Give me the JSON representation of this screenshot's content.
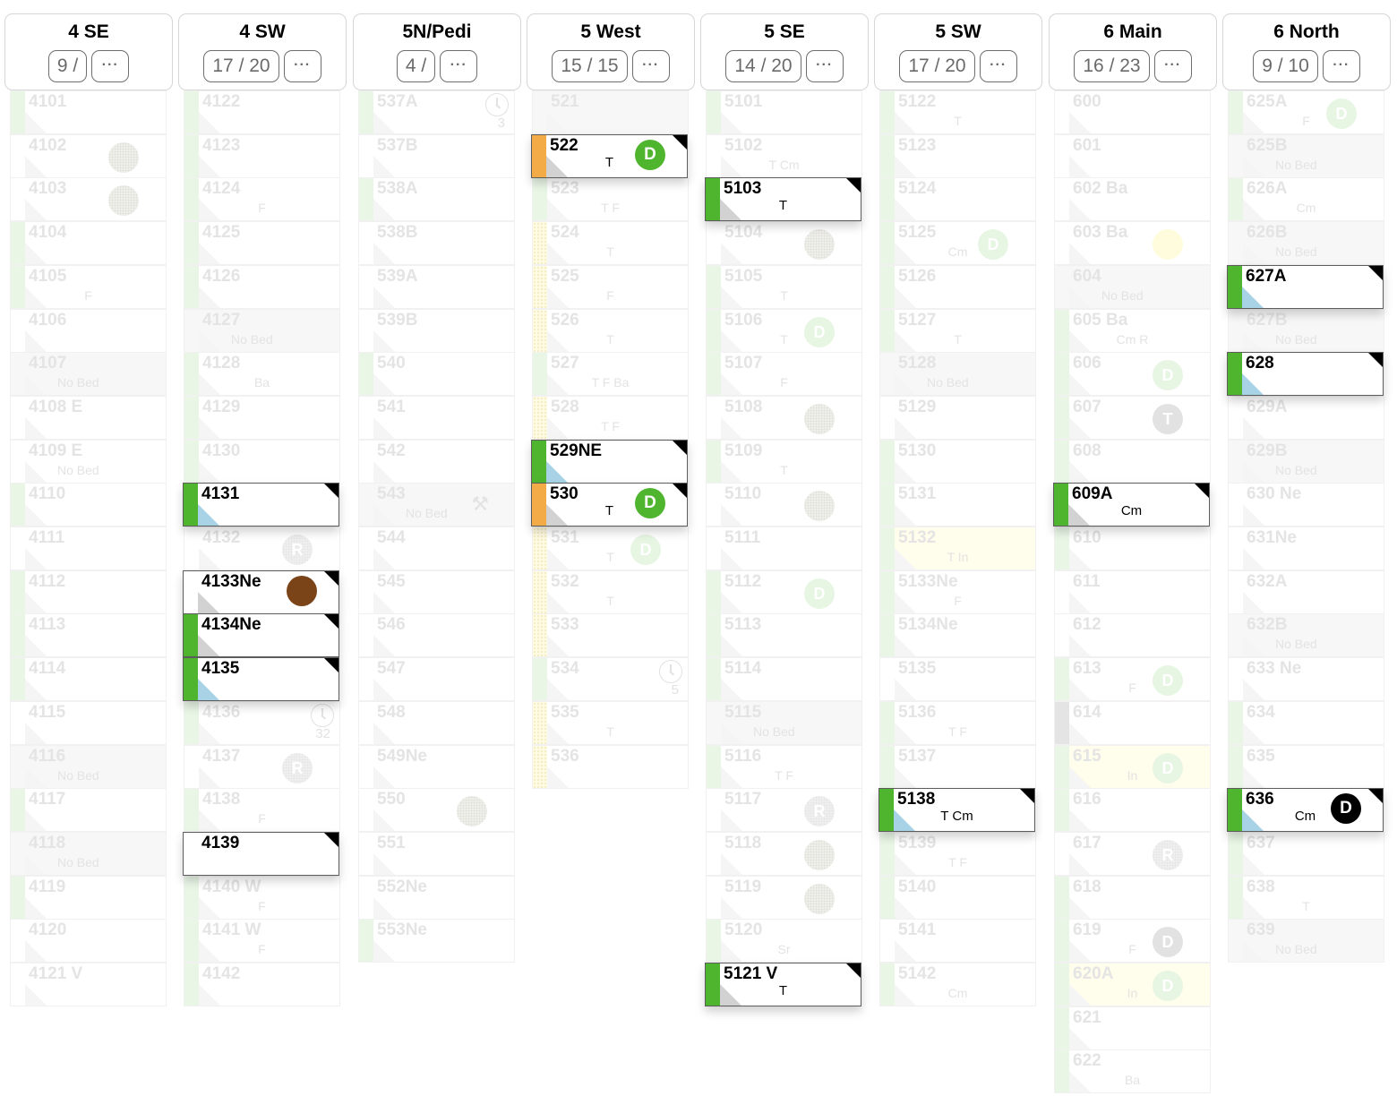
{
  "units": [
    {
      "name": "4 SE",
      "count": "9 /",
      "more": "···",
      "rooms": [
        {
          "n": "4101",
          "strip": "green"
        },
        {
          "n": "4102",
          "badge": "dot"
        },
        {
          "n": "4103",
          "badge": "dot"
        },
        {
          "n": "4104",
          "strip": "green"
        },
        {
          "n": "4105",
          "strip": "green",
          "sub": "F"
        },
        {
          "n": "4106"
        },
        {
          "n": "4107",
          "nobed": true,
          "sub": "No Bed"
        },
        {
          "n": "4108 E"
        },
        {
          "n": "4109 E",
          "nobed": false,
          "sub": "No Bed"
        },
        {
          "n": "4110",
          "strip": "green"
        },
        {
          "n": "4111"
        },
        {
          "n": "4112",
          "strip": "green"
        },
        {
          "n": "4113",
          "strip": "green"
        },
        {
          "n": "4114",
          "strip": "green"
        },
        {
          "n": "4115"
        },
        {
          "n": "4116",
          "nobed": true,
          "sub": "No Bed"
        },
        {
          "n": "4117",
          "strip": "green"
        },
        {
          "n": "4118",
          "nobed": true,
          "sub": "No Bed"
        },
        {
          "n": "4119",
          "strip": "green"
        },
        {
          "n": "4120"
        },
        {
          "n": "4121 V"
        }
      ],
      "cards": []
    },
    {
      "name": "4 SW",
      "count": "17 / 20",
      "more": "···",
      "rooms": [
        {
          "n": "4122",
          "strip": "green"
        },
        {
          "n": "4123",
          "strip": "green"
        },
        {
          "n": "4124",
          "strip": "green",
          "sub": "F"
        },
        {
          "n": "4125",
          "strip": "green"
        },
        {
          "n": "4126",
          "strip": "green"
        },
        {
          "n": "4127",
          "nobed": true,
          "sub": "No Bed"
        },
        {
          "n": "4128",
          "strip": "green",
          "sub": "Ba"
        },
        {
          "n": "4129",
          "strip": "green"
        },
        {
          "n": "4130",
          "strip": "green"
        },
        {
          "n": "4131",
          "hidden": true
        },
        {
          "n": "4132",
          "badge": "r",
          "badgeText": "R"
        },
        {
          "n": "4133Ne",
          "hidden": true
        },
        {
          "n": "4134Ne",
          "hidden": true
        },
        {
          "n": "4135",
          "hidden": true
        },
        {
          "n": "4136",
          "strip": "green",
          "clock": "32"
        },
        {
          "n": "4137",
          "badge": "r",
          "badgeText": "R"
        },
        {
          "n": "4138",
          "strip": "green",
          "sub": "F"
        },
        {
          "n": "4139",
          "hidden": true
        },
        {
          "n": "4140 W",
          "strip": "green",
          "sub": "F"
        },
        {
          "n": "4141 W",
          "strip": "green",
          "sub": "F"
        },
        {
          "n": "4142",
          "strip": "green"
        }
      ],
      "cards": [
        {
          "row": 9,
          "n": "4131",
          "strip": "green",
          "tri": "blue"
        },
        {
          "row": 11,
          "n": "4133Ne",
          "tri": "gray",
          "badge": "brown",
          "badgeText": ""
        },
        {
          "row": 12,
          "n": "4134Ne",
          "strip": "green",
          "tri": "gray"
        },
        {
          "row": 13,
          "n": "4135",
          "strip": "green",
          "tri": "blue"
        },
        {
          "row": 17,
          "n": "4139"
        }
      ]
    },
    {
      "name": "5N/Pedi",
      "count": "4 /",
      "more": "···",
      "rooms": [
        {
          "n": "537A",
          "strip": "green",
          "clock": "3"
        },
        {
          "n": "537B"
        },
        {
          "n": "538A",
          "strip": "green"
        },
        {
          "n": "538B"
        },
        {
          "n": "539A"
        },
        {
          "n": "539B"
        },
        {
          "n": "540",
          "strip": "green"
        },
        {
          "n": "541"
        },
        {
          "n": "542"
        },
        {
          "n": "543",
          "nobed": true,
          "sub": "No Bed",
          "wrench": true
        },
        {
          "n": "544"
        },
        {
          "n": "545"
        },
        {
          "n": "546"
        },
        {
          "n": "547"
        },
        {
          "n": "548"
        },
        {
          "n": "549Ne"
        },
        {
          "n": "550",
          "badge": "dot"
        },
        {
          "n": "551"
        },
        {
          "n": "552Ne"
        },
        {
          "n": "553Ne",
          "strip": "green"
        }
      ],
      "cards": []
    },
    {
      "name": "5 West",
      "count": "15 / 15",
      "more": "···",
      "rooms": [
        {
          "n": "521",
          "nobed": true
        },
        {
          "n": "522",
          "hidden": true
        },
        {
          "n": "523",
          "strip": "green",
          "sub": "T F"
        },
        {
          "n": "524",
          "strip": "yellowdot",
          "sub": "T"
        },
        {
          "n": "525",
          "strip": "yellowdot",
          "sub": "F"
        },
        {
          "n": "526",
          "strip": "yellowdot",
          "sub": "T"
        },
        {
          "n": "527",
          "strip": "green",
          "sub": "T F Ba"
        },
        {
          "n": "528",
          "strip": "yellowdot",
          "sub": "T F"
        },
        {
          "n": "529NE",
          "hidden": true
        },
        {
          "n": "530",
          "hidden": true
        },
        {
          "n": "531",
          "strip": "yellowdot",
          "sub": "T",
          "badge": "dgreen",
          "badgeText": "D"
        },
        {
          "n": "532",
          "strip": "yellowdot",
          "sub": "T"
        },
        {
          "n": "533",
          "strip": "yellowdot"
        },
        {
          "n": "534",
          "strip": "green",
          "clock": "5"
        },
        {
          "n": "535",
          "strip": "yellowdot",
          "sub": "T"
        },
        {
          "n": "536",
          "strip": "yellowdot"
        }
      ],
      "cards": [
        {
          "row": 1,
          "n": "522",
          "strip": "orange",
          "tri": "gray",
          "sub": "T",
          "badge": "green",
          "badgeText": "D"
        },
        {
          "row": 8,
          "n": "529NE",
          "strip": "green",
          "tri": "blue"
        },
        {
          "row": 9,
          "n": "530",
          "strip": "orange",
          "tri": "gray",
          "sub": "T",
          "badge": "green",
          "badgeText": "D"
        }
      ]
    },
    {
      "name": "5 SE",
      "count": "14 / 20",
      "more": "···",
      "rooms": [
        {
          "n": "5101",
          "strip": "green"
        },
        {
          "n": "5102",
          "sub": "T Cm"
        },
        {
          "n": "5103",
          "hidden": true
        },
        {
          "n": "5104",
          "badge": "dot"
        },
        {
          "n": "5105",
          "strip": "green",
          "sub": "T"
        },
        {
          "n": "5106",
          "strip": "green",
          "sub": "T",
          "badge": "dgreen",
          "badgeText": "D"
        },
        {
          "n": "5107",
          "strip": "green",
          "sub": "F"
        },
        {
          "n": "5108",
          "badge": "dot"
        },
        {
          "n": "5109",
          "strip": "green",
          "sub": "T"
        },
        {
          "n": "5110",
          "badge": "dot"
        },
        {
          "n": "5111"
        },
        {
          "n": "5112",
          "strip": "green",
          "badge": "dgreen",
          "badgeText": "D"
        },
        {
          "n": "5113",
          "strip": "green"
        },
        {
          "n": "5114",
          "strip": "green"
        },
        {
          "n": "5115",
          "nobed": true,
          "sub": "No Bed"
        },
        {
          "n": "5116",
          "strip": "green",
          "sub": "T F"
        },
        {
          "n": "5117",
          "badge": "r",
          "badgeText": "R"
        },
        {
          "n": "5118",
          "badge": "dot"
        },
        {
          "n": "5119",
          "badge": "dot"
        },
        {
          "n": "5120",
          "strip": "green",
          "sub": "Sr"
        },
        {
          "n": "5121 V",
          "hidden": true
        }
      ],
      "cards": [
        {
          "row": 2,
          "n": "5103",
          "strip": "green",
          "tri": "gray",
          "sub": "T"
        },
        {
          "row": 20,
          "n": "5121 V",
          "strip": "green",
          "tri": "gray",
          "sub": "T"
        }
      ]
    },
    {
      "name": "5 SW",
      "count": "17 / 20",
      "more": "···",
      "rooms": [
        {
          "n": "5122",
          "strip": "green",
          "sub": "T"
        },
        {
          "n": "5123",
          "strip": "green"
        },
        {
          "n": "5124",
          "strip": "green"
        },
        {
          "n": "5125",
          "strip": "green",
          "sub": "Cm",
          "badge": "dgreen",
          "badgeText": "D"
        },
        {
          "n": "5126",
          "strip": "green"
        },
        {
          "n": "5127",
          "strip": "green",
          "sub": "T"
        },
        {
          "n": "5128",
          "nobed": true,
          "sub": "No Bed"
        },
        {
          "n": "5129"
        },
        {
          "n": "5130",
          "strip": "green"
        },
        {
          "n": "5131",
          "strip": "green"
        },
        {
          "n": "5132",
          "strip": "green",
          "yellow": true,
          "sub": "T In"
        },
        {
          "n": "5133Ne",
          "strip": "green",
          "sub": "F"
        },
        {
          "n": "5134Ne",
          "strip": "green"
        },
        {
          "n": "5135"
        },
        {
          "n": "5136",
          "strip": "green",
          "sub": "T F"
        },
        {
          "n": "5137",
          "strip": "green"
        },
        {
          "n": "5138",
          "hidden": true
        },
        {
          "n": "5139",
          "strip": "green",
          "sub": "T F"
        },
        {
          "n": "5140",
          "strip": "green"
        },
        {
          "n": "5141"
        },
        {
          "n": "5142",
          "strip": "green",
          "sub": "Cm"
        }
      ],
      "cards": [
        {
          "row": 16,
          "n": "5138",
          "strip": "green",
          "tri": "blue",
          "sub": "T Cm"
        }
      ]
    },
    {
      "name": "6 Main",
      "count": "16 / 23",
      "more": "···",
      "rooms": [
        {
          "n": "600"
        },
        {
          "n": "601"
        },
        {
          "n": "602 Ba"
        },
        {
          "n": "603 Ba",
          "badge": "yel"
        },
        {
          "n": "604",
          "nobed": true,
          "sub": "No Bed"
        },
        {
          "n": "605 Ba",
          "strip": "green",
          "sub": "Cm R"
        },
        {
          "n": "606",
          "strip": "green",
          "badge": "dgreen",
          "badgeText": "D"
        },
        {
          "n": "607",
          "strip": "green",
          "badge": "gray",
          "badgeText": "T"
        },
        {
          "n": "608",
          "strip": "green"
        },
        {
          "n": "609A",
          "hidden": true
        },
        {
          "n": "610",
          "strip": "green"
        },
        {
          "n": "611"
        },
        {
          "n": "612"
        },
        {
          "n": "613",
          "strip": "green",
          "sub": "F",
          "badge": "dgreen",
          "badgeText": "D"
        },
        {
          "n": "614",
          "strip": "gray"
        },
        {
          "n": "615",
          "strip": "green",
          "yellow": true,
          "sub": "In",
          "badge": "dgreen",
          "badgeText": "D"
        },
        {
          "n": "616",
          "strip": "green"
        },
        {
          "n": "617",
          "badge": "r",
          "badgeText": "R"
        },
        {
          "n": "618",
          "strip": "green"
        },
        {
          "n": "619",
          "strip": "green",
          "sub": "F",
          "badge": "gray",
          "badgeText": "D"
        },
        {
          "n": "620A",
          "strip": "green",
          "yellow": true,
          "sub": "In",
          "badge": "dgreen",
          "badgeText": "D"
        },
        {
          "n": "621",
          "strip": "green"
        },
        {
          "n": "622",
          "strip": "green",
          "sub": "Ba"
        }
      ],
      "cards": [
        {
          "row": 9,
          "n": "609A",
          "strip": "green",
          "tri": "gray",
          "sub": "Cm"
        }
      ]
    },
    {
      "name": "6 North",
      "count": "9 / 10",
      "more": "···",
      "rooms": [
        {
          "n": "625A",
          "strip": "green",
          "sub": "F",
          "badge": "dgreen",
          "badgeText": "D"
        },
        {
          "n": "625B",
          "nobed": true,
          "sub": "No Bed"
        },
        {
          "n": "626A",
          "strip": "green",
          "sub": "Cm"
        },
        {
          "n": "626B",
          "nobed": true,
          "sub": "No Bed"
        },
        {
          "n": "627A",
          "hidden": true
        },
        {
          "n": "627B",
          "nobed": true,
          "sub": "No Bed"
        },
        {
          "n": "628",
          "hidden": true
        },
        {
          "n": "629A"
        },
        {
          "n": "629B",
          "nobed": true,
          "sub": "No Bed"
        },
        {
          "n": "630 Ne"
        },
        {
          "n": "631Ne"
        },
        {
          "n": "632A"
        },
        {
          "n": "632B",
          "nobed": true,
          "sub": "No Bed"
        },
        {
          "n": "633 Ne"
        },
        {
          "n": "634",
          "strip": "green"
        },
        {
          "n": "635",
          "strip": "green"
        },
        {
          "n": "636",
          "hidden": true
        },
        {
          "n": "637",
          "strip": "green"
        },
        {
          "n": "638",
          "strip": "green",
          "sub": "T"
        },
        {
          "n": "639",
          "nobed": true,
          "sub": "No Bed"
        }
      ],
      "cards": [
        {
          "row": 4,
          "n": "627A",
          "strip": "green",
          "tri": "blue"
        },
        {
          "row": 6,
          "n": "628",
          "strip": "green",
          "tri": "blue"
        },
        {
          "row": 16,
          "n": "636",
          "strip": "green",
          "tri": "blue",
          "sub": "Cm",
          "badge": "black",
          "badgeText": "D"
        }
      ]
    }
  ]
}
